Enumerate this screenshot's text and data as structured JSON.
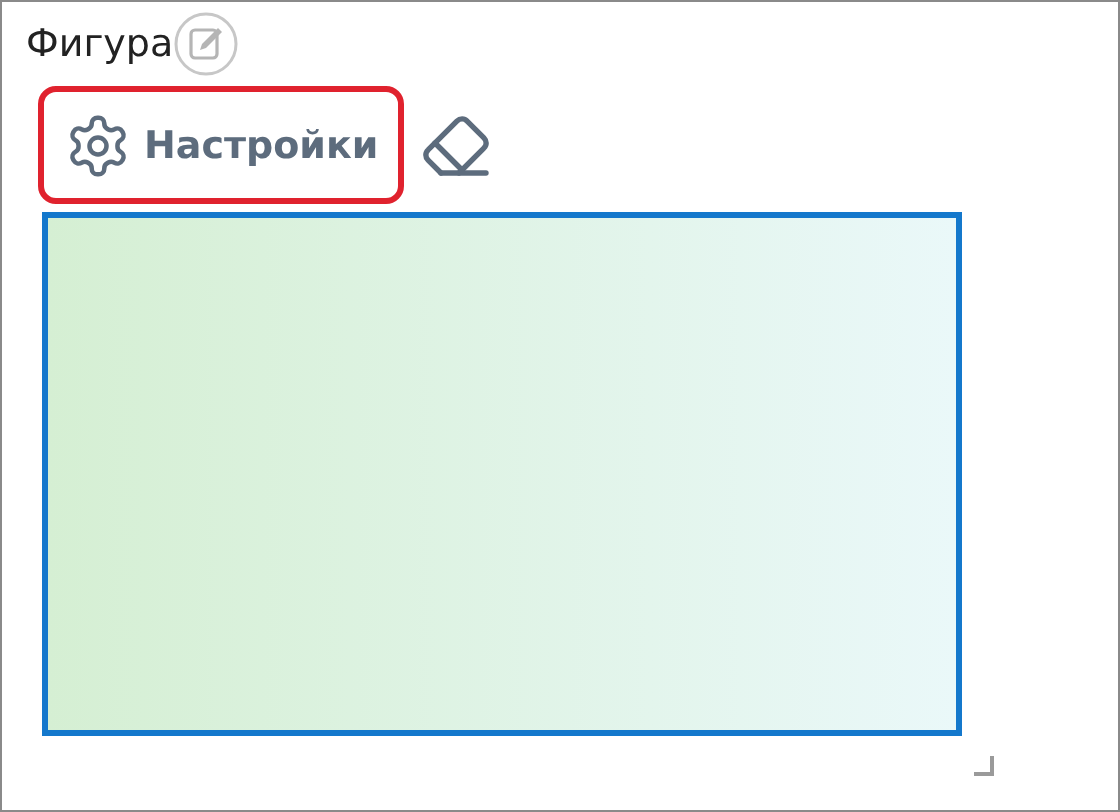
{
  "title": "Фигура",
  "settings_button": {
    "label": "Настройки",
    "highlighted": true
  },
  "shape": {
    "kind": "rectangle",
    "selected": true
  }
}
